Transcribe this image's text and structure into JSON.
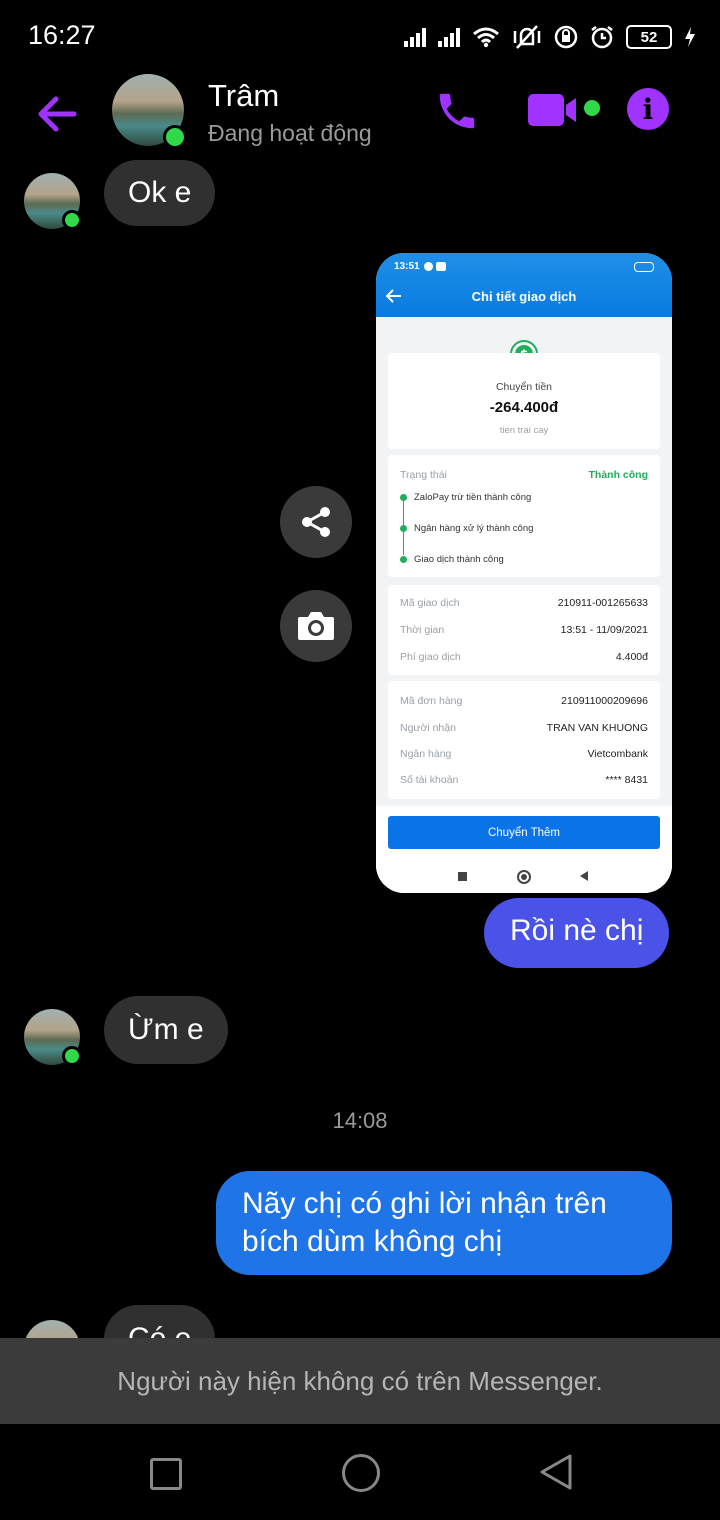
{
  "status_bar": {
    "time": "16:27",
    "battery": "52"
  },
  "header": {
    "contact_name": "Trâm",
    "contact_status": "Đang hoạt động"
  },
  "messages": {
    "m1": "Ok e",
    "m2": "Rồi nè chị",
    "m3": "Ừm e",
    "timestamp": "14:08",
    "m4_line1": "Nãy chị có ghi lời nhận trên",
    "m4_line2": "bích dùm không chị",
    "m5": "Có e"
  },
  "shared_image": {
    "time": "13:51",
    "title": "Chi tiết giao dịch",
    "type_label": "Chuyển tiền",
    "amount": "-264.400đ",
    "note": "tien trai cay",
    "status_label": "Trạng thái",
    "status_value": "Thành công",
    "steps": [
      "ZaloPay trừ tiền thành công",
      "Ngân hàng xử lý thành công",
      "Giao dịch thành công"
    ],
    "details1": [
      {
        "k": "Mã giao dịch",
        "v": "210911-001265633"
      },
      {
        "k": "Thời gian",
        "v": "13:51 - 11/09/2021"
      },
      {
        "k": "Phí giao dịch",
        "v": "4.400đ"
      }
    ],
    "details2": [
      {
        "k": "Mã đơn hàng",
        "v": "210911000209696"
      },
      {
        "k": "Người nhận",
        "v": "TRAN VAN KHUONG"
      },
      {
        "k": "Ngân hàng",
        "v": "Vietcombank"
      },
      {
        "k": "Số tài khoản",
        "v": "**** 8431"
      }
    ],
    "button": "Chuyển Thêm"
  },
  "notice": "Người này hiện không có trên Messenger.",
  "colors": {
    "accent": "#a033ff",
    "outgoing_bubble": "#1f74e8",
    "outgoing_bubble_alt": "#4a52e8",
    "online": "#31d84a",
    "incoming_bubble": "#303030"
  }
}
